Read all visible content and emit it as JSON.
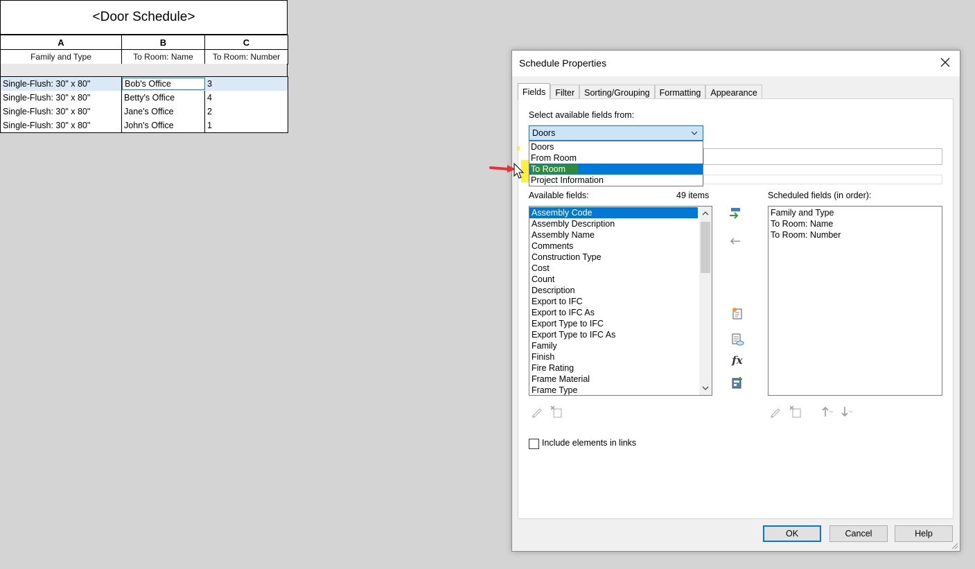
{
  "schedule": {
    "title": "<Door Schedule>",
    "column_letters": [
      "A",
      "B",
      "C"
    ],
    "column_headers": [
      "Family and Type",
      "To Room: Name",
      "To Room: Number"
    ],
    "rows": [
      {
        "family_type": "Single-Flush: 30\" x 80\"",
        "room_name": "Bob's Office",
        "room_number": "3"
      },
      {
        "family_type": "Single-Flush: 30\" x 80\"",
        "room_name": "Betty's Office",
        "room_number": "4"
      },
      {
        "family_type": "Single-Flush: 30\" x 80\"",
        "room_name": "Jane's Office",
        "room_number": "2"
      },
      {
        "family_type": "Single-Flush: 30\" x 80\"",
        "room_name": "John's Office",
        "room_number": "1"
      }
    ]
  },
  "dialog": {
    "title": "Schedule Properties",
    "tabs": [
      "Fields",
      "Filter",
      "Sorting/Grouping",
      "Formatting",
      "Appearance"
    ],
    "active_tab": "Fields",
    "select_from_label": "Select available fields from:",
    "select_from_value": "Doors",
    "dropdown_options": [
      "Doors",
      "From Room",
      "To Room",
      "Project Information"
    ],
    "highlighted_option": "To Room",
    "available_label": "Available fields:",
    "item_count": "49 items",
    "available_fields": [
      "Assembly Code",
      "Assembly Description",
      "Assembly Name",
      "Comments",
      "Construction Type",
      "Cost",
      "Count",
      "Description",
      "Export to IFC",
      "Export to IFC As",
      "Export Type to IFC",
      "Export Type to IFC As",
      "Family",
      "Finish",
      "Fire Rating",
      "Frame Material",
      "Frame Type"
    ],
    "selected_available": "Assembly Code",
    "scheduled_label": "Scheduled fields (in order):",
    "scheduled_fields": [
      "Family and Type",
      "To Room: Name",
      "To Room: Number"
    ],
    "include_links_label": "Include elements in links",
    "include_links_checked": false,
    "buttons": {
      "ok": "OK",
      "cancel": "Cancel",
      "help": "Help"
    },
    "fx_label": "fx"
  },
  "colors": {
    "selection_blue": "#0078d7",
    "highlight_yellow": "#ffeb00",
    "arrow_red": "#e8312f"
  }
}
